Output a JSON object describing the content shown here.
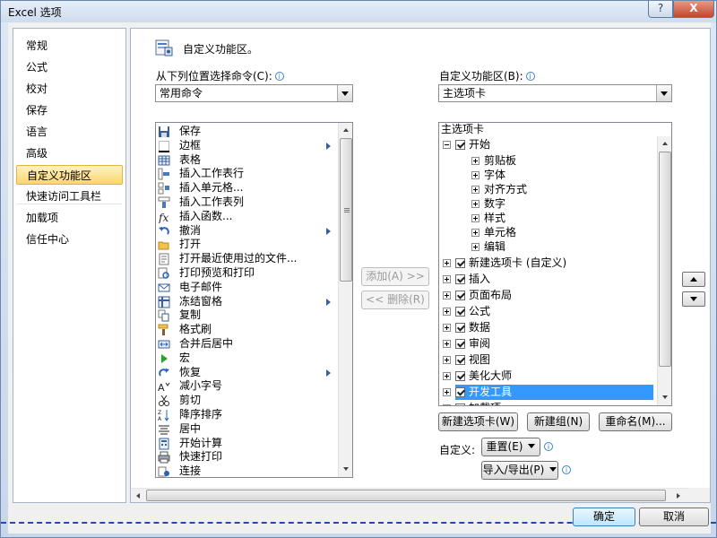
{
  "window": {
    "title": "Excel 选项",
    "help": "?",
    "close": "X"
  },
  "nav": {
    "items": [
      "常规",
      "公式",
      "校对",
      "保存",
      "语言",
      "高级",
      "自定义功能区",
      "快速访问工具栏",
      "加载项",
      "信任中心"
    ],
    "selected_index": 6
  },
  "header": {
    "text": "自定义功能区。"
  },
  "left": {
    "label": "从下列位置选择命令(C):",
    "dropdown_value": "常用命令",
    "commands": [
      {
        "label": "保存",
        "icon": "save-icon",
        "submenu": false
      },
      {
        "label": "边框",
        "icon": "border-icon",
        "submenu": true
      },
      {
        "label": "表格",
        "icon": "table-icon",
        "submenu": false
      },
      {
        "label": "插入工作表行",
        "icon": "insert-row-icon",
        "submenu": false
      },
      {
        "label": "插入单元格...",
        "icon": "insert-cells-icon",
        "submenu": false
      },
      {
        "label": "插入工作表列",
        "icon": "insert-column-icon",
        "submenu": false
      },
      {
        "label": "插入函数...",
        "icon": "function-icon",
        "submenu": false
      },
      {
        "label": "撤消",
        "icon": "undo-icon",
        "submenu": true
      },
      {
        "label": "打开",
        "icon": "open-folder-icon",
        "submenu": false
      },
      {
        "label": "打开最近使用过的文件...",
        "icon": "recent-file-icon",
        "submenu": false
      },
      {
        "label": "打印预览和打印",
        "icon": "print-preview-icon",
        "submenu": false
      },
      {
        "label": "电子邮件",
        "icon": "email-icon",
        "submenu": false
      },
      {
        "label": "冻结窗格",
        "icon": "freeze-panes-icon",
        "submenu": true
      },
      {
        "label": "复制",
        "icon": "copy-icon",
        "submenu": false
      },
      {
        "label": "格式刷",
        "icon": "format-painter-icon",
        "submenu": false
      },
      {
        "label": "合并后居中",
        "icon": "merge-center-icon",
        "submenu": false
      },
      {
        "label": "宏",
        "icon": "macro-icon",
        "submenu": false
      },
      {
        "label": "恢复",
        "icon": "redo-icon",
        "submenu": true
      },
      {
        "label": "减小字号",
        "icon": "decrease-font-icon",
        "submenu": false
      },
      {
        "label": "剪切",
        "icon": "cut-icon",
        "submenu": false
      },
      {
        "label": "降序排序",
        "icon": "sort-descending-icon",
        "submenu": false
      },
      {
        "label": "居中",
        "icon": "align-center-icon",
        "submenu": false
      },
      {
        "label": "开始计算",
        "icon": "calculate-icon",
        "submenu": false
      },
      {
        "label": "快速打印",
        "icon": "quick-print-icon",
        "submenu": false
      },
      {
        "label": "连接",
        "icon": "connections-icon",
        "submenu": false
      }
    ]
  },
  "middle": {
    "add_label": "添加(A) >>",
    "remove_label": "<< 删除(R)"
  },
  "right": {
    "label": "自定义功能区(B):",
    "dropdown_value": "主选项卡",
    "tree_header": "主选项卡",
    "tree": [
      {
        "label": "开始",
        "level": 0,
        "expander": "minus",
        "checkbox": true,
        "selected": false
      },
      {
        "label": "剪贴板",
        "level": 1,
        "expander": "plus",
        "checkbox": false,
        "selected": false
      },
      {
        "label": "字体",
        "level": 1,
        "expander": "plus",
        "checkbox": false,
        "selected": false
      },
      {
        "label": "对齐方式",
        "level": 1,
        "expander": "plus",
        "checkbox": false,
        "selected": false
      },
      {
        "label": "数字",
        "level": 1,
        "expander": "plus",
        "checkbox": false,
        "selected": false
      },
      {
        "label": "样式",
        "level": 1,
        "expander": "plus",
        "checkbox": false,
        "selected": false
      },
      {
        "label": "单元格",
        "level": 1,
        "expander": "plus",
        "checkbox": false,
        "selected": false
      },
      {
        "label": "编辑",
        "level": 1,
        "expander": "plus",
        "checkbox": false,
        "selected": false
      },
      {
        "label": "新建选项卡 (自定义)",
        "level": 0,
        "expander": "plus",
        "checkbox": true,
        "selected": false
      },
      {
        "label": "插入",
        "level": 0,
        "expander": "plus",
        "checkbox": true,
        "selected": false
      },
      {
        "label": "页面布局",
        "level": 0,
        "expander": "plus",
        "checkbox": true,
        "selected": false
      },
      {
        "label": "公式",
        "level": 0,
        "expander": "plus",
        "checkbox": true,
        "selected": false
      },
      {
        "label": "数据",
        "level": 0,
        "expander": "plus",
        "checkbox": true,
        "selected": false
      },
      {
        "label": "审阅",
        "level": 0,
        "expander": "plus",
        "checkbox": true,
        "selected": false
      },
      {
        "label": "视图",
        "level": 0,
        "expander": "plus",
        "checkbox": true,
        "selected": false
      },
      {
        "label": "美化大师",
        "level": 0,
        "expander": "plus",
        "checkbox": true,
        "selected": false
      },
      {
        "label": "开发工具",
        "level": 0,
        "expander": "plus",
        "checkbox": true,
        "selected": true
      },
      {
        "label": "加载项",
        "level": 0,
        "expander": "plus",
        "checkbox": true,
        "selected": false
      }
    ],
    "new_tab_label": "新建选项卡(W)",
    "new_group_label": "新建组(N)",
    "rename_label": "重命名(M)...",
    "custom_label": "自定义:",
    "reset_label": "重置(E)",
    "import_export_label": "导入/导出(P)"
  },
  "footer": {
    "ok_label": "确定",
    "cancel_label": "取消"
  },
  "colors": {
    "selection": "#3399ff",
    "nav_selected": "#fbd66e",
    "dashed_line": "#1e49b6"
  }
}
